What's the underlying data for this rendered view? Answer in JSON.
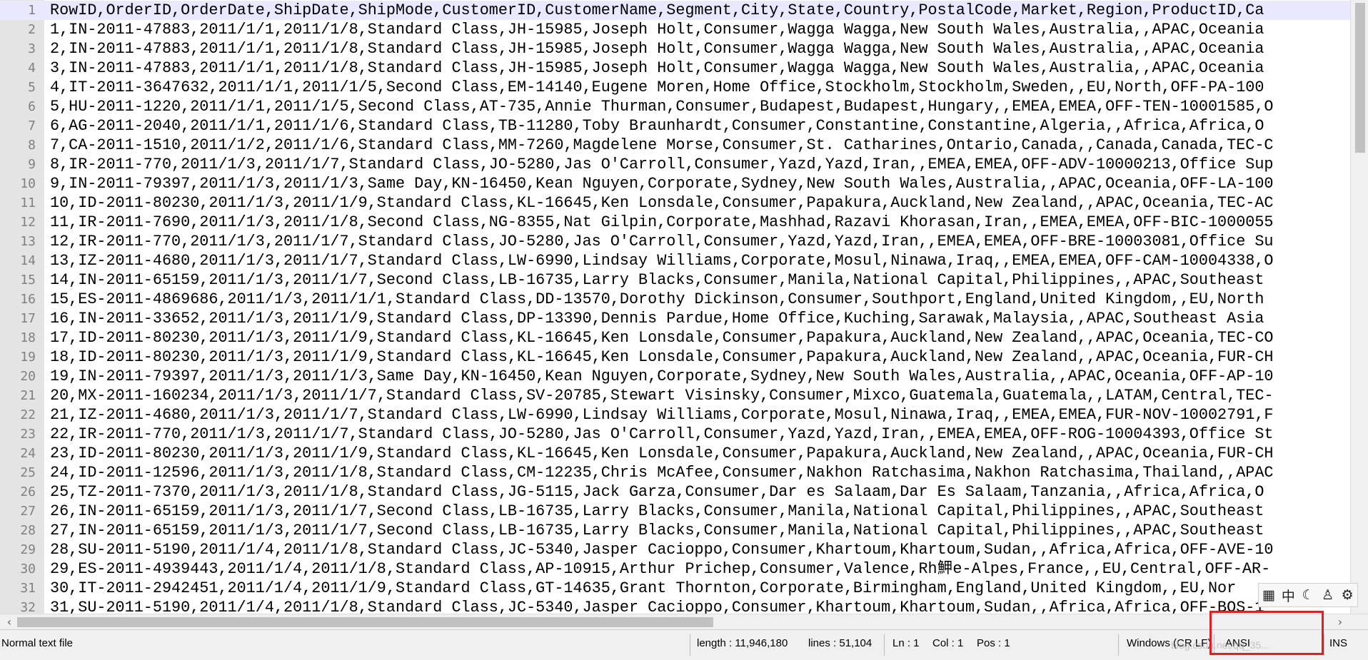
{
  "lines": [
    {
      "num": "1",
      "text": "RowID,OrderID,OrderDate,ShipDate,ShipMode,CustomerID,CustomerName,Segment,City,State,Country,PostalCode,Market,Region,ProductID,Ca"
    },
    {
      "num": "2",
      "text": "1,IN-2011-47883,2011/1/1,2011/1/8,Standard Class,JH-15985,Joseph Holt,Consumer,Wagga Wagga,New South Wales,Australia,,APAC,Oceania"
    },
    {
      "num": "3",
      "text": "2,IN-2011-47883,2011/1/1,2011/1/8,Standard Class,JH-15985,Joseph Holt,Consumer,Wagga Wagga,New South Wales,Australia,,APAC,Oceania"
    },
    {
      "num": "4",
      "text": "3,IN-2011-47883,2011/1/1,2011/1/8,Standard Class,JH-15985,Joseph Holt,Consumer,Wagga Wagga,New South Wales,Australia,,APAC,Oceania"
    },
    {
      "num": "5",
      "text": "4,IT-2011-3647632,2011/1/1,2011/1/5,Second Class,EM-14140,Eugene Moren,Home Office,Stockholm,Stockholm,Sweden,,EU,North,OFF-PA-100"
    },
    {
      "num": "6",
      "text": "5,HU-2011-1220,2011/1/1,2011/1/5,Second Class,AT-735,Annie Thurman,Consumer,Budapest,Budapest,Hungary,,EMEA,EMEA,OFF-TEN-10001585,O"
    },
    {
      "num": "7",
      "text": "6,AG-2011-2040,2011/1/1,2011/1/6,Standard Class,TB-11280,Toby Braunhardt,Consumer,Constantine,Constantine,Algeria,,Africa,Africa,O"
    },
    {
      "num": "8",
      "text": "7,CA-2011-1510,2011/1/2,2011/1/6,Standard Class,MM-7260,Magdelene Morse,Consumer,St. Catharines,Ontario,Canada,,Canada,Canada,TEC-C"
    },
    {
      "num": "9",
      "text": "8,IR-2011-770,2011/1/3,2011/1/7,Standard Class,JO-5280,Jas O'Carroll,Consumer,Yazd,Yazd,Iran,,EMEA,EMEA,OFF-ADV-10000213,Office Sup"
    },
    {
      "num": "10",
      "text": "9,IN-2011-79397,2011/1/3,2011/1/3,Same Day,KN-16450,Kean Nguyen,Corporate,Sydney,New South Wales,Australia,,APAC,Oceania,OFF-LA-100"
    },
    {
      "num": "11",
      "text": "10,ID-2011-80230,2011/1/3,2011/1/9,Standard Class,KL-16645,Ken Lonsdale,Consumer,Papakura,Auckland,New Zealand,,APAC,Oceania,TEC-AC"
    },
    {
      "num": "12",
      "text": "11,IR-2011-7690,2011/1/3,2011/1/8,Second Class,NG-8355,Nat Gilpin,Corporate,Mashhad,Razavi Khorasan,Iran,,EMEA,EMEA,OFF-BIC-1000055"
    },
    {
      "num": "13",
      "text": "12,IR-2011-770,2011/1/3,2011/1/7,Standard Class,JO-5280,Jas O'Carroll,Consumer,Yazd,Yazd,Iran,,EMEA,EMEA,OFF-BRE-10003081,Office Su"
    },
    {
      "num": "14",
      "text": "13,IZ-2011-4680,2011/1/3,2011/1/7,Standard Class,LW-6990,Lindsay Williams,Corporate,Mosul,Ninawa,Iraq,,EMEA,EMEA,OFF-CAM-10004338,O"
    },
    {
      "num": "15",
      "text": "14,IN-2011-65159,2011/1/3,2011/1/7,Second Class,LB-16735,Larry Blacks,Consumer,Manila,National Capital,Philippines,,APAC,Southeast"
    },
    {
      "num": "16",
      "text": "15,ES-2011-4869686,2011/1/3,2011/1/1,Standard Class,DD-13570,Dorothy Dickinson,Consumer,Southport,England,United Kingdom,,EU,North"
    },
    {
      "num": "17",
      "text": "16,IN-2011-33652,2011/1/3,2011/1/9,Standard Class,DP-13390,Dennis Pardue,Home Office,Kuching,Sarawak,Malaysia,,APAC,Southeast Asia"
    },
    {
      "num": "18",
      "text": "17,ID-2011-80230,2011/1/3,2011/1/9,Standard Class,KL-16645,Ken Lonsdale,Consumer,Papakura,Auckland,New Zealand,,APAC,Oceania,TEC-CO"
    },
    {
      "num": "19",
      "text": "18,ID-2011-80230,2011/1/3,2011/1/9,Standard Class,KL-16645,Ken Lonsdale,Consumer,Papakura,Auckland,New Zealand,,APAC,Oceania,FUR-CH"
    },
    {
      "num": "20",
      "text": "19,IN-2011-79397,2011/1/3,2011/1/3,Same Day,KN-16450,Kean Nguyen,Corporate,Sydney,New South Wales,Australia,,APAC,Oceania,OFF-AP-10"
    },
    {
      "num": "21",
      "text": "20,MX-2011-160234,2011/1/3,2011/1/7,Standard Class,SV-20785,Stewart Visinsky,Consumer,Mixco,Guatemala,Guatemala,,LATAM,Central,TEC-"
    },
    {
      "num": "22",
      "text": "21,IZ-2011-4680,2011/1/3,2011/1/7,Standard Class,LW-6990,Lindsay Williams,Corporate,Mosul,Ninawa,Iraq,,EMEA,EMEA,FUR-NOV-10002791,F"
    },
    {
      "num": "23",
      "text": "22,IR-2011-770,2011/1/3,2011/1/7,Standard Class,JO-5280,Jas O'Carroll,Consumer,Yazd,Yazd,Iran,,EMEA,EMEA,OFF-ROG-10004393,Office St"
    },
    {
      "num": "24",
      "text": "23,ID-2011-80230,2011/1/3,2011/1/9,Standard Class,KL-16645,Ken Lonsdale,Consumer,Papakura,Auckland,New Zealand,,APAC,Oceania,FUR-CH"
    },
    {
      "num": "25",
      "text": "24,ID-2011-12596,2011/1/3,2011/1/8,Standard Class,CM-12235,Chris McAfee,Consumer,Nakhon Ratchasima,Nakhon Ratchasima,Thailand,,APAC"
    },
    {
      "num": "26",
      "text": "25,TZ-2011-7370,2011/1/3,2011/1/8,Standard Class,JG-5115,Jack Garza,Consumer,Dar es Salaam,Dar Es Salaam,Tanzania,,Africa,Africa,O"
    },
    {
      "num": "27",
      "text": "26,IN-2011-65159,2011/1/3,2011/1/7,Second Class,LB-16735,Larry Blacks,Consumer,Manila,National Capital,Philippines,,APAC,Southeast"
    },
    {
      "num": "28",
      "text": "27,IN-2011-65159,2011/1/3,2011/1/7,Second Class,LB-16735,Larry Blacks,Consumer,Manila,National Capital,Philippines,,APAC,Southeast"
    },
    {
      "num": "29",
      "text": "28,SU-2011-5190,2011/1/4,2011/1/8,Standard Class,JC-5340,Jasper Cacioppo,Consumer,Khartoum,Khartoum,Sudan,,Africa,Africa,OFF-AVE-10"
    },
    {
      "num": "30",
      "text": "29,ES-2011-4939443,2011/1/4,2011/1/8,Standard Class,AP-10915,Arthur Prichep,Consumer,Valence,Rh魻e-Alpes,France,,EU,Central,OFF-AR-"
    },
    {
      "num": "31",
      "text": "30,IT-2011-2942451,2011/1/4,2011/1/9,Standard Class,GT-14635,Grant Thornton,Corporate,Birmingham,England,United Kingdom,,EU,Nor"
    },
    {
      "num": "32",
      "text": "31,SU-2011-5190,2011/1/4,2011/1/8,Standard Class,JC-5340,Jasper Cacioppo,Consumer,Khartoum,Khartoum,Sudan,,Africa,Africa,OFF-BOS-1"
    }
  ],
  "status": {
    "file_type": "Normal text file",
    "length": "length : 11,946,180",
    "lines": "lines : 51,104",
    "ln": "Ln : 1",
    "col": "Col : 1",
    "pos": "Pos : 1",
    "eol": "Windows (CR LF)",
    "encoding": "ANSI",
    "mode": "INS"
  },
  "watermark": "blog.csdn.net/qq_35...",
  "scroll": {
    "left_arrow": "‹",
    "right_arrow": "›"
  },
  "ime": {
    "icons": [
      "grid-icon",
      "chinese-input-icon",
      "moon-icon",
      "user-icon",
      "gear-icon"
    ],
    "glyphs": [
      "▦",
      "中",
      "☾",
      "♙",
      "⚙"
    ]
  },
  "colors": {
    "gutter": "#e4e4e4",
    "current_line": "#e8e8ff",
    "highlight_box": "#e02020"
  }
}
